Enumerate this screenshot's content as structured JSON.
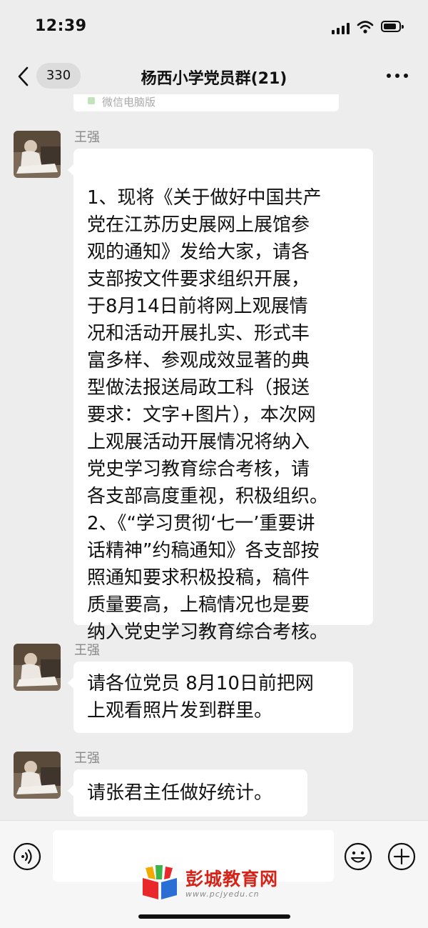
{
  "status_bar": {
    "time": "12:39"
  },
  "header": {
    "back_count": "330",
    "title": "杨西小学党员群(21)"
  },
  "previous_message": {
    "text": "微信电脑版"
  },
  "messages": [
    {
      "sender": "王强",
      "lines": [
        "1、现将《关于做好中国共产",
        "党在江苏历史展网上展馆参",
        "观的通知》发给大家，请各",
        "支部按文件要求组织开展，",
        "于8月14日前将网上观展情",
        "况和活动开展扎实、形式丰",
        "富多样、参观成效显著的典",
        "型做法报送局政工科（报送",
        "要求：文字+图片），本次网",
        "上观展活动开展情况将纳入",
        "党史学习教育综合考核，请",
        "各支部高度重视，积极组织。",
        "2、《“学习贯彻‘七一’重要讲",
        "话精神”约稿通知》各支部按",
        "照通知要求积极投稿，稿件",
        "质量要高，上稿情况也是要",
        "纳入党史学习教育综合考核。"
      ]
    },
    {
      "sender": "王强",
      "lines": [
        "请各位党员 8月10日前把网",
        "上观看照片发到群里。"
      ]
    },
    {
      "sender": "王强",
      "lines": [
        "请张君主任做好统计。"
      ]
    }
  ],
  "watermark": {
    "title": "彭城教育网",
    "url": "www.pcjyedu.cn"
  },
  "colors": {
    "background": "#ededed",
    "bubble": "#ffffff",
    "watermark_red": "#d62318"
  }
}
